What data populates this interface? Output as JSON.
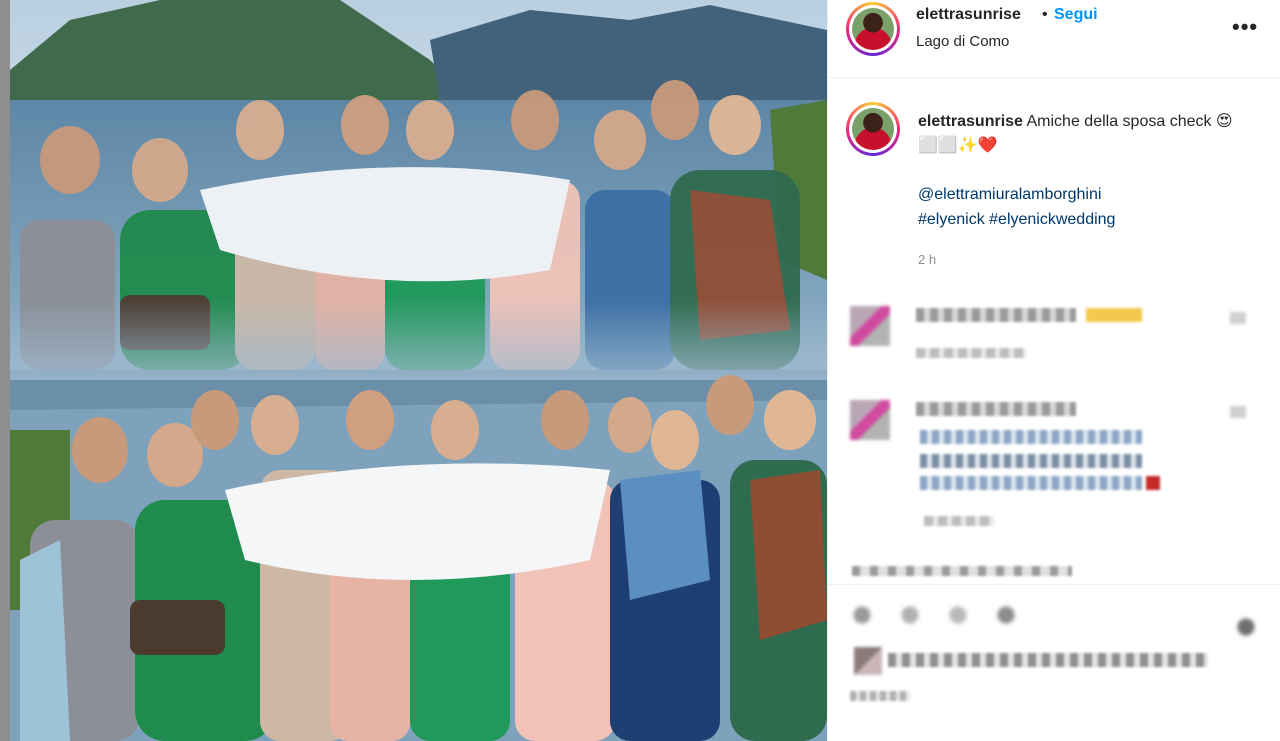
{
  "post": {
    "username": "elettrasunrise",
    "follow_label": "Segui",
    "location": "Lago di Como",
    "caption_text": "Amiche della sposa check 😍⬜⬜✨❤️",
    "mention": "@elettramiuralamborghini",
    "hashtags": "#elyenick #elyenickwedding",
    "time": "2 h",
    "more_icon": "more-horizontal-icon"
  },
  "colors": {
    "follow": "#0095f6",
    "link": "#00376b",
    "muted": "#8e8e8e",
    "border": "#efefef"
  }
}
